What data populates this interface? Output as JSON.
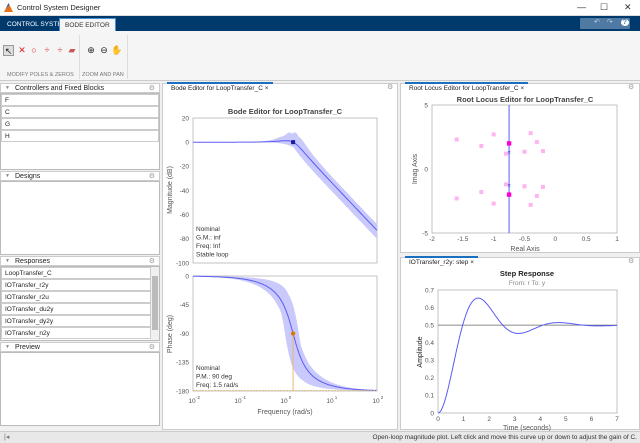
{
  "window": {
    "title": "Control System Designer",
    "controls": [
      "—",
      "☐",
      "✕"
    ]
  },
  "ribbon": {
    "tabs": [
      {
        "label": "CONTROL SYSTEM",
        "active": false
      },
      {
        "label": "BODE EDITOR",
        "active": true
      }
    ],
    "quick_access": {
      "undo": "↶",
      "redo": "↷",
      "help": "?"
    },
    "sections": [
      {
        "label": "MODIFY POLES & ZEROS",
        "tools": [
          "pointer-icon",
          "add-pole-icon",
          "add-zero-icon",
          "add-lead-icon",
          "add-lag-icon",
          "eraser-icon"
        ]
      },
      {
        "label": "ZOOM AND PAN",
        "tools": [
          "zoom-in-icon",
          "zoom-out-icon",
          "pan-hand-icon"
        ]
      }
    ]
  },
  "left": {
    "controllers": {
      "title": "Controllers and Fixed Blocks",
      "items": [
        "F",
        "C",
        "G",
        "H"
      ]
    },
    "designs": {
      "title": "Designs",
      "items": []
    },
    "responses": {
      "title": "Responses",
      "items": [
        "LoopTransfer_C",
        "IOTransfer_r2y",
        "IOTransfer_r2u",
        "IOTransfer_du2y",
        "IOTransfer_dy2y",
        "IOTransfer_n2y"
      ]
    },
    "preview": {
      "title": "Preview"
    }
  },
  "tabs": {
    "bode": "Bode Editor for LoopTransfer_C",
    "rlocus": "Root Locus Editor for LoopTransfer_C",
    "step": "IOTransfer_r2y: step",
    "close": "×"
  },
  "colors": {
    "ribbon": "#003a6c",
    "nominal": "#5b5bf5",
    "band": "#c9c9fb",
    "marker": "#d97706",
    "cl_pole": "#ff00cc",
    "uncertain_pole": "#ffb3f0"
  },
  "chart_data": [
    {
      "type": "line",
      "title": "Bode Editor for LoopTransfer_C",
      "ylabel": "Magnitude (dB)",
      "xscale": "log",
      "xlim": [
        0.01,
        100
      ],
      "ylim": [
        -100,
        20
      ],
      "yticks": [
        "20",
        "0",
        "-20",
        "-40",
        "-60",
        "-80",
        "-100"
      ],
      "gain_marker": {
        "freq": 1.5,
        "mag": 0
      },
      "annotation": [
        "Nominal",
        "G.M.: inf",
        "Freq: Inf",
        "Stable loop"
      ]
    },
    {
      "type": "line",
      "ylabel": "Phase (deg)",
      "xlabel": "Frequency (rad/s)",
      "xscale": "log",
      "xlim": [
        0.01,
        100
      ],
      "ylim": [
        -180,
        0
      ],
      "yticks": [
        "0",
        "-45",
        "-90",
        "-135",
        "-180"
      ],
      "xticks": [
        "10",
        "10",
        "10",
        "10",
        "10"
      ],
      "xtick_exps": [
        "-2",
        "-1",
        "0",
        "1",
        "2"
      ],
      "phase_marker": {
        "freq": 1.5,
        "phase": -90
      },
      "annotation": [
        "Nominal",
        "P.M.: 90 deg",
        "Freq: 1.5 rad/s"
      ]
    },
    {
      "type": "scatter",
      "title": "Root Locus Editor for LoopTransfer_C",
      "xlabel": "Real Axis",
      "ylabel": "Imag Axis",
      "xlim": [
        -2,
        1
      ],
      "ylim": [
        -5,
        5
      ],
      "xticks": [
        "-2",
        "-1.5",
        "-1",
        "-0.5",
        "0",
        "0.5",
        "1"
      ],
      "yticks": [
        "5",
        "0",
        "-5"
      ],
      "open_loop_poles": [
        [
          -0.75,
          1.3
        ],
        [
          -0.75,
          -1.3
        ]
      ],
      "closed_loop_poles": [
        [
          -0.75,
          2.0
        ],
        [
          -0.75,
          -2.0
        ]
      ],
      "uncertain_poles": [
        [
          -1.6,
          2.3
        ],
        [
          -1.2,
          1.8
        ],
        [
          -1.0,
          2.7
        ],
        [
          -0.8,
          1.2
        ],
        [
          -0.5,
          1.35
        ],
        [
          -0.4,
          2.8
        ],
        [
          -0.3,
          2.1
        ],
        [
          -0.2,
          1.4
        ]
      ]
    },
    {
      "type": "line",
      "title": "Step Response",
      "subtitle": "From: r  To: y",
      "xlabel": "Time (seconds)",
      "ylabel": "Amplitude",
      "xlim": [
        0,
        7
      ],
      "ylim": [
        0,
        0.7
      ],
      "xticks": [
        "0",
        "1",
        "2",
        "3",
        "4",
        "5",
        "6",
        "7"
      ],
      "yticks": [
        "0",
        "0.1",
        "0.2",
        "0.3",
        "0.4",
        "0.5",
        "0.6",
        "0.7"
      ],
      "final_value": 0.5,
      "peak": {
        "t": 1.57,
        "y": 0.654
      }
    }
  ],
  "status": {
    "message": "Open-loop magnitude plot. Left click and move this curve up or down to adjust the gain of C."
  }
}
